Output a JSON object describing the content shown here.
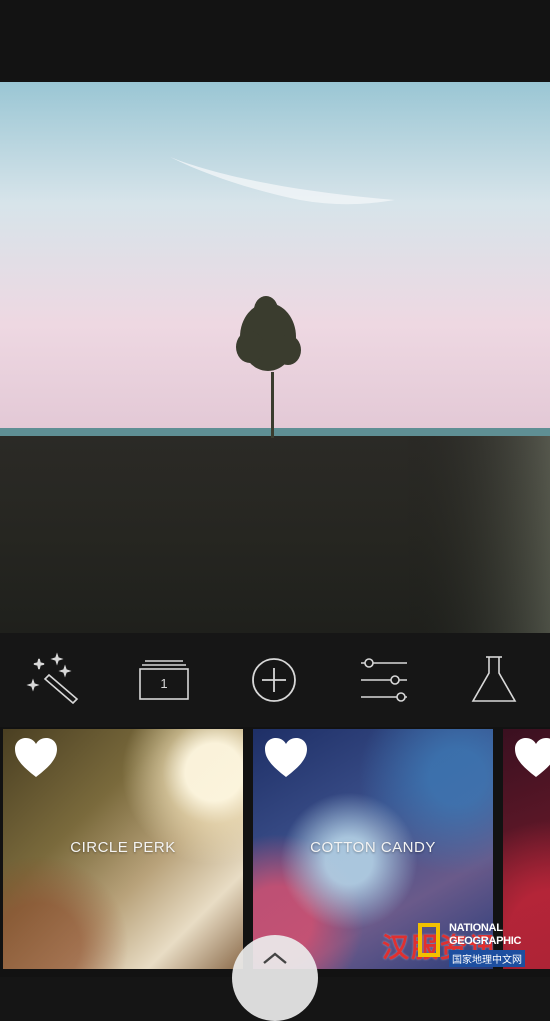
{
  "toolbar": {
    "tools": [
      {
        "name": "magic-wand-icon"
      },
      {
        "name": "layers-icon",
        "count": "1"
      },
      {
        "name": "add-circle-icon"
      },
      {
        "name": "sliders-icon"
      },
      {
        "name": "flask-icon"
      }
    ]
  },
  "filters": [
    {
      "label": "CIRCLE PERK",
      "favorite_icon": "heart-icon",
      "selected": true
    },
    {
      "label": "COTTON CANDY",
      "favorite_icon": "heart-icon",
      "selected": false
    },
    {
      "label": "",
      "favorite_icon": "heart-icon",
      "selected": false
    }
  ],
  "expand_icon": "chevron-up-icon",
  "watermark": {
    "text": "汉服资讯",
    "brand_line1": "NATIONAL",
    "brand_line2": "GEOGRAPHIC",
    "brand_sub": "国家地理中文网"
  },
  "colors": {
    "background": "#151515",
    "icon": "#d8d8d8",
    "watermark_red": "#e03030",
    "natgeo_yellow": "#f2c100"
  }
}
